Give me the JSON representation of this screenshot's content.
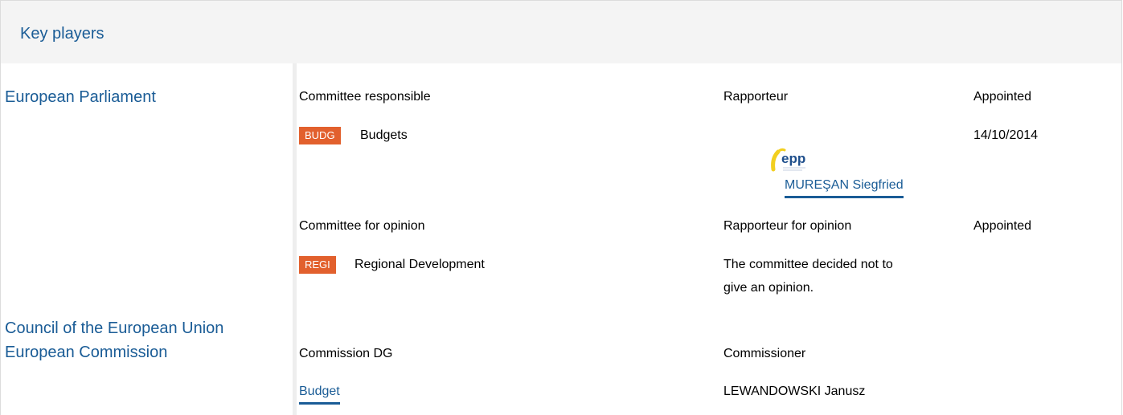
{
  "section_title": "Key players",
  "institutions": {
    "ep": "European Parliament",
    "council": "Council of the European Union",
    "commission": "European Commission"
  },
  "ep": {
    "responsible": {
      "header_committee": "Committee responsible",
      "header_rapporteur": "Rapporteur",
      "header_appointed": "Appointed",
      "committee_code": "BUDG",
      "committee_name": "Budgets",
      "appointed_date": "14/10/2014",
      "group_logo_text": "epp",
      "rapporteur_name": "MUREŞAN Siegfried"
    },
    "opinion": {
      "header_committee": "Committee for opinion",
      "header_rapporteur": "Rapporteur for opinion",
      "header_appointed": "Appointed",
      "committee_code": "REGI",
      "committee_name": "Regional Development",
      "note_line1": "The committee decided not to",
      "note_line2": "give an opinion."
    }
  },
  "commission": {
    "header_dg": "Commission DG",
    "header_commissioner": "Commissioner",
    "dg_name": "Budget",
    "commissioner_name": "LEWANDOWSKI Janusz"
  },
  "colors": {
    "link_blue": "#1a5c96",
    "badge_orange": "#e2602d",
    "header_bg": "#f4f4f4"
  }
}
